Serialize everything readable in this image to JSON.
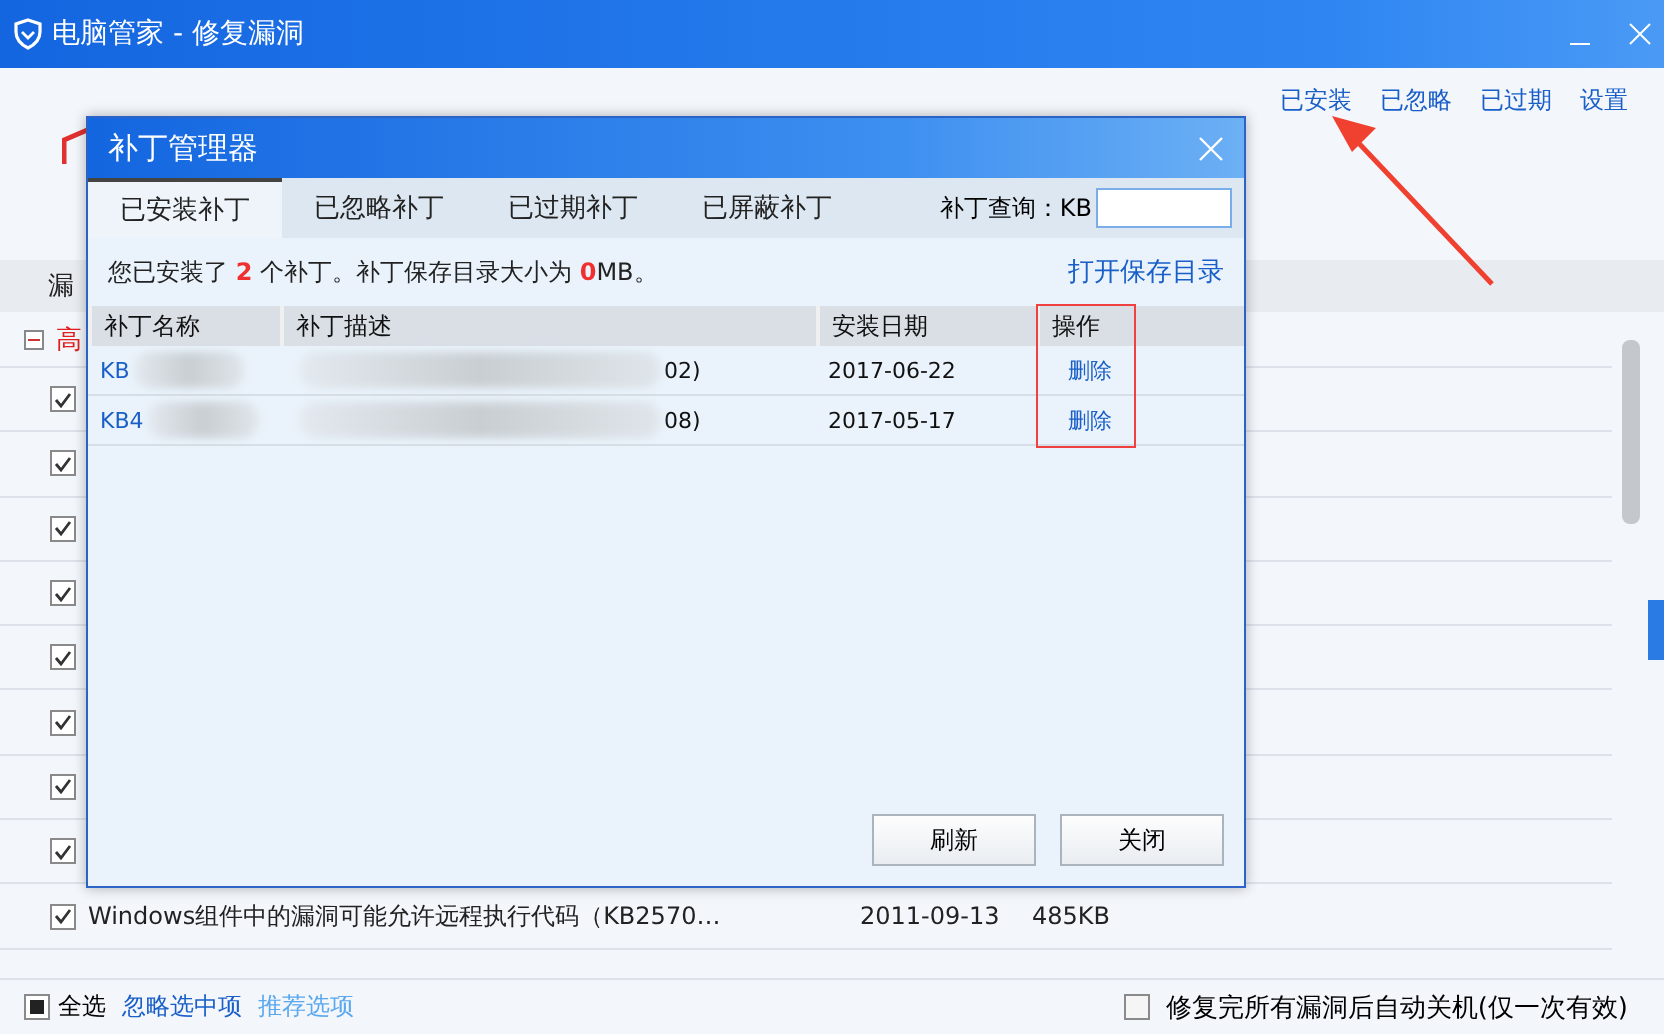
{
  "window": {
    "title": "电脑管家 - 修复漏洞"
  },
  "top_links": [
    {
      "label": "已安装"
    },
    {
      "label": "已忽略"
    },
    {
      "label": "已过期"
    },
    {
      "label": "设置"
    }
  ],
  "list": {
    "header_partial": "漏",
    "group_partial": "高",
    "group_expanded": true,
    "rows": [
      {
        "checked": true
      },
      {
        "checked": true
      },
      {
        "checked": true
      },
      {
        "checked": true
      },
      {
        "checked": true
      },
      {
        "checked": true
      },
      {
        "checked": true
      },
      {
        "checked": true
      },
      {
        "checked": true,
        "title": "Windows组件中的漏洞可能允许远程执行代码（KB2570…",
        "date": "2011-09-13",
        "size": "485KB"
      }
    ]
  },
  "footer": {
    "select_all": {
      "label": "全选",
      "checked": true
    },
    "links": [
      {
        "label": "忽略选中项",
        "muted": false
      },
      {
        "label": "推荐选项",
        "muted": true
      }
    ],
    "auto_shutdown": {
      "label": "修复完所有漏洞后自动关机(仅一次有效)",
      "checked": false
    }
  },
  "dialog": {
    "title": "补丁管理器",
    "tabs": [
      {
        "label": "已安装补丁",
        "selected": true
      },
      {
        "label": "已忽略补丁",
        "selected": false
      },
      {
        "label": "已过期补丁",
        "selected": false
      },
      {
        "label": "已屏蔽补丁",
        "selected": false
      }
    ],
    "search": {
      "label": "补丁查询：KB"
    },
    "summary": {
      "before": "您已安装了",
      "count": "2",
      "middle": "个补丁。补丁保存目录大小为",
      "size": "0",
      "unit": "MB。"
    },
    "open_folder": "打开保存目录",
    "columns": [
      "补丁名称",
      "补丁描述",
      "安装日期",
      "操作"
    ],
    "rows": [
      {
        "name": "KB",
        "description": "02)",
        "date": "2017-06-22",
        "action": "删除"
      },
      {
        "name": "KB4",
        "description": "08)",
        "date": "2017-05-17",
        "action": "删除"
      }
    ],
    "buttons": [
      "刷新",
      "关闭"
    ]
  }
}
